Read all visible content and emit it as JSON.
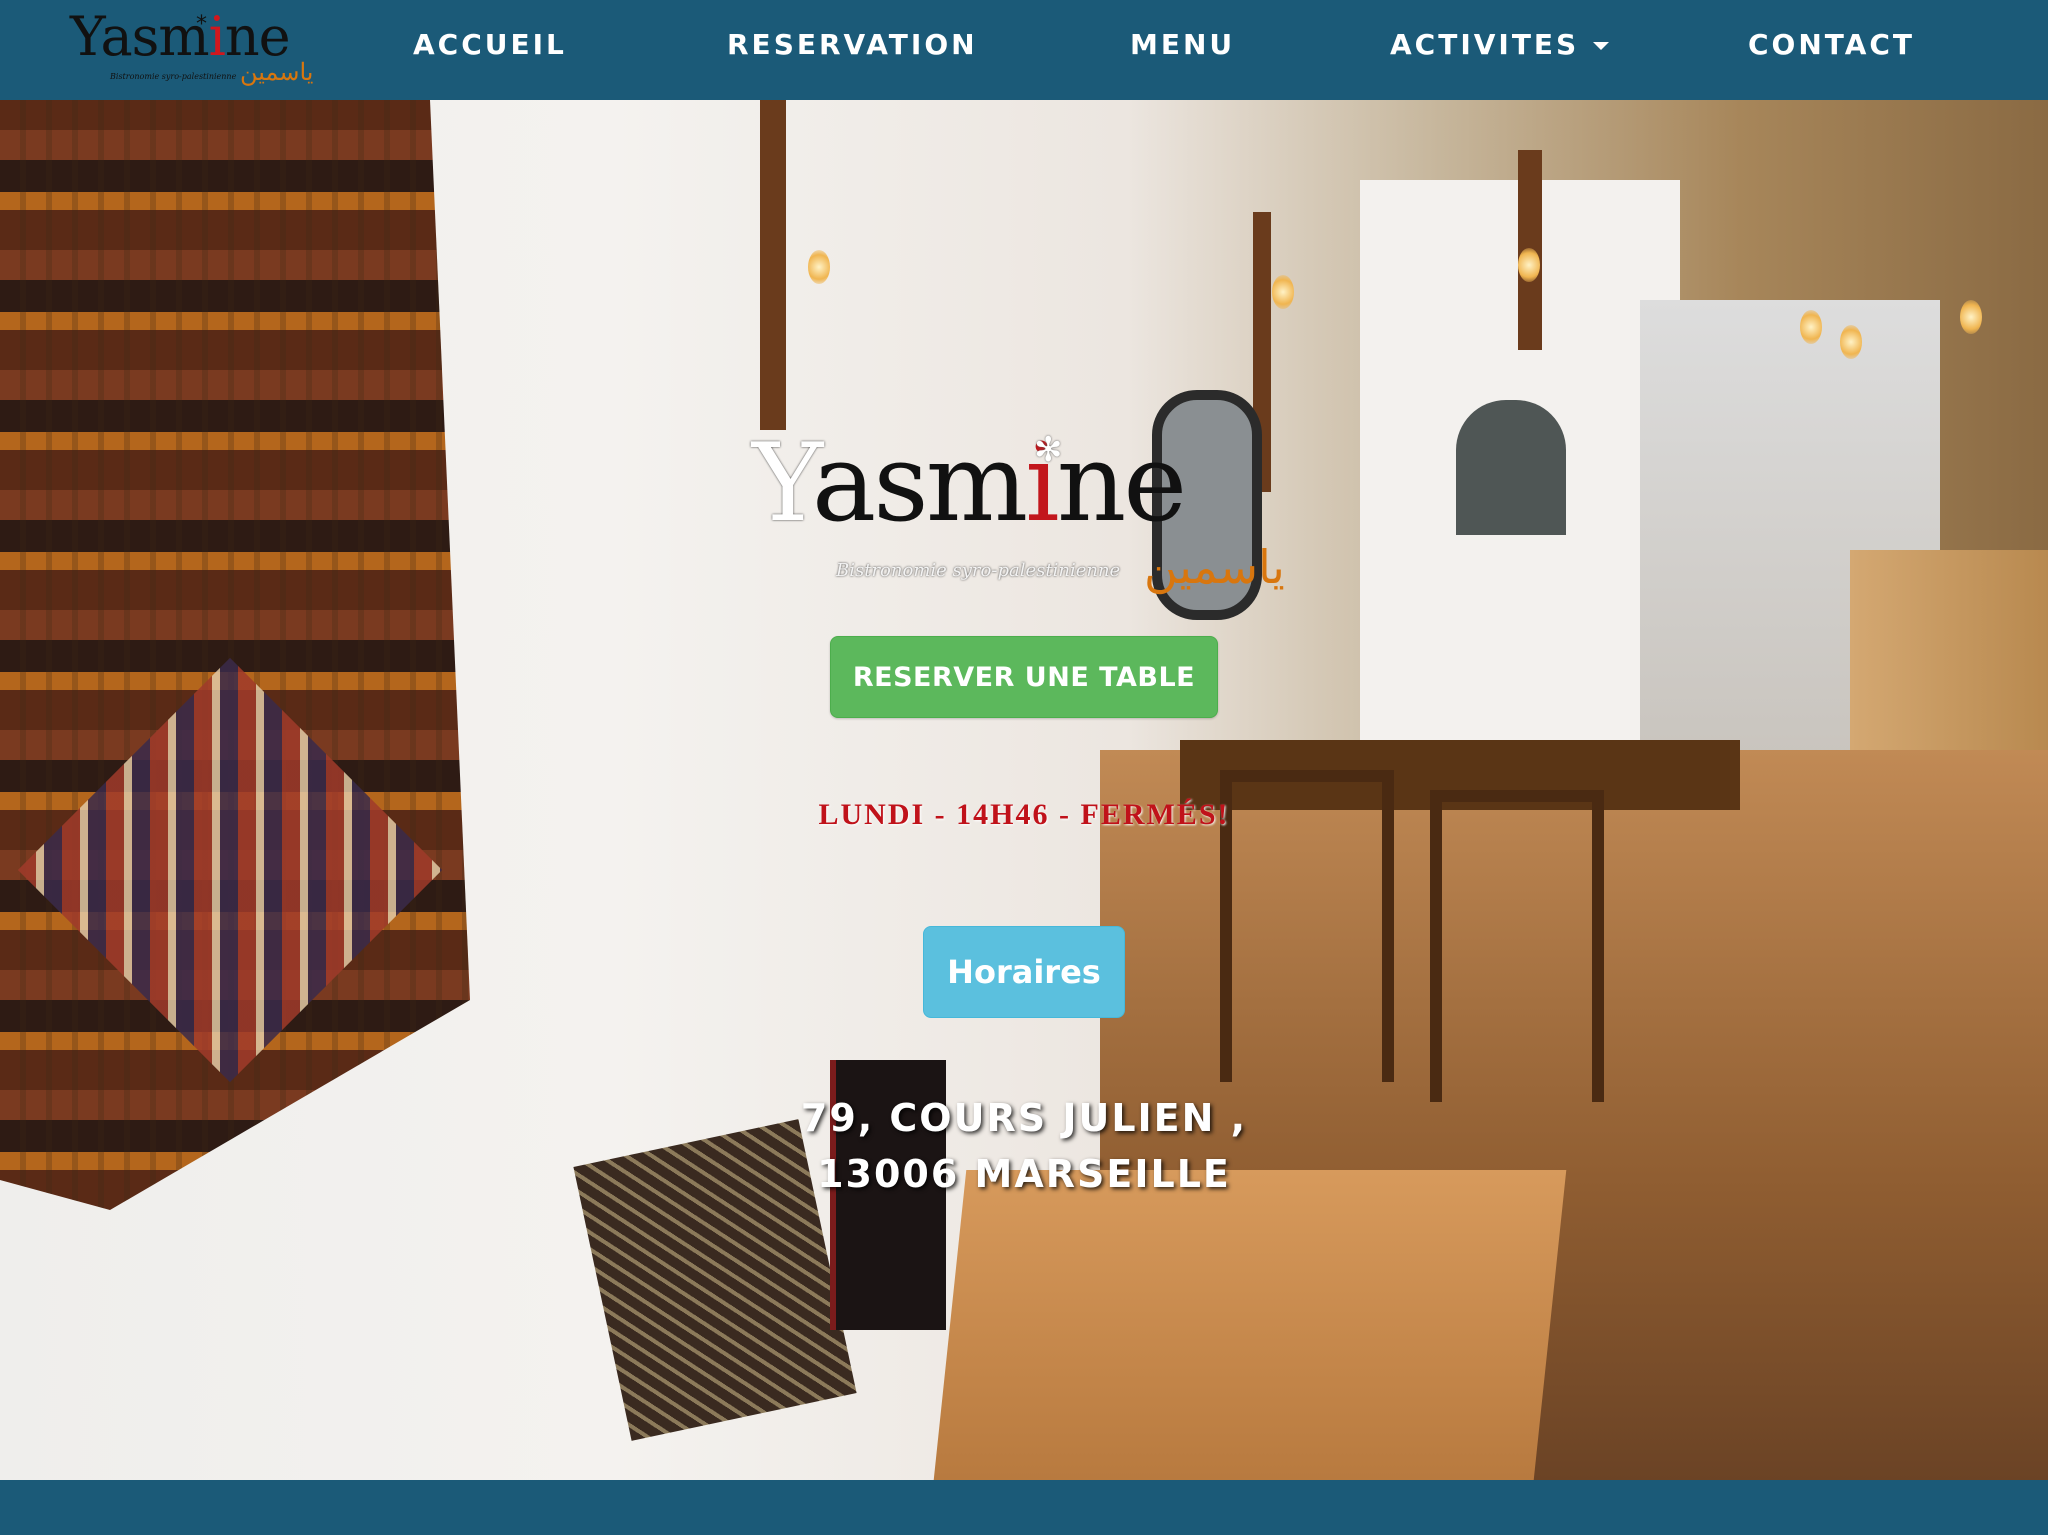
{
  "nav": {
    "brand": {
      "name": "Yasmine",
      "tagline": "Bistronomie syro-palestinienne",
      "arabic": "ياسمين"
    },
    "items": [
      {
        "label": "ACCUEIL"
      },
      {
        "label": "RESERVATION"
      },
      {
        "label": "MENU"
      },
      {
        "label": "ACTIVITES",
        "has_dropdown": true
      },
      {
        "label": "CONTACT"
      }
    ]
  },
  "hero": {
    "logo": {
      "name": "Yasmine",
      "tagline": "Bistronomie syro-palestinienne",
      "arabic": "ياسمين"
    },
    "reserve_button": "RESERVER UNE TABLE",
    "status": "LUNDI - 14H46 - FERMÉS!",
    "hours_button": "Horaires",
    "address_line1": "79, COURS JULIEN ,",
    "address_line2": "13006 MARSEILLE"
  },
  "colors": {
    "navbar": "#1b5a78",
    "reserve_button": "#5cb85c",
    "hours_button": "#5bc0de",
    "status_text": "#c0121a",
    "logo_accent": "#d8760e"
  }
}
